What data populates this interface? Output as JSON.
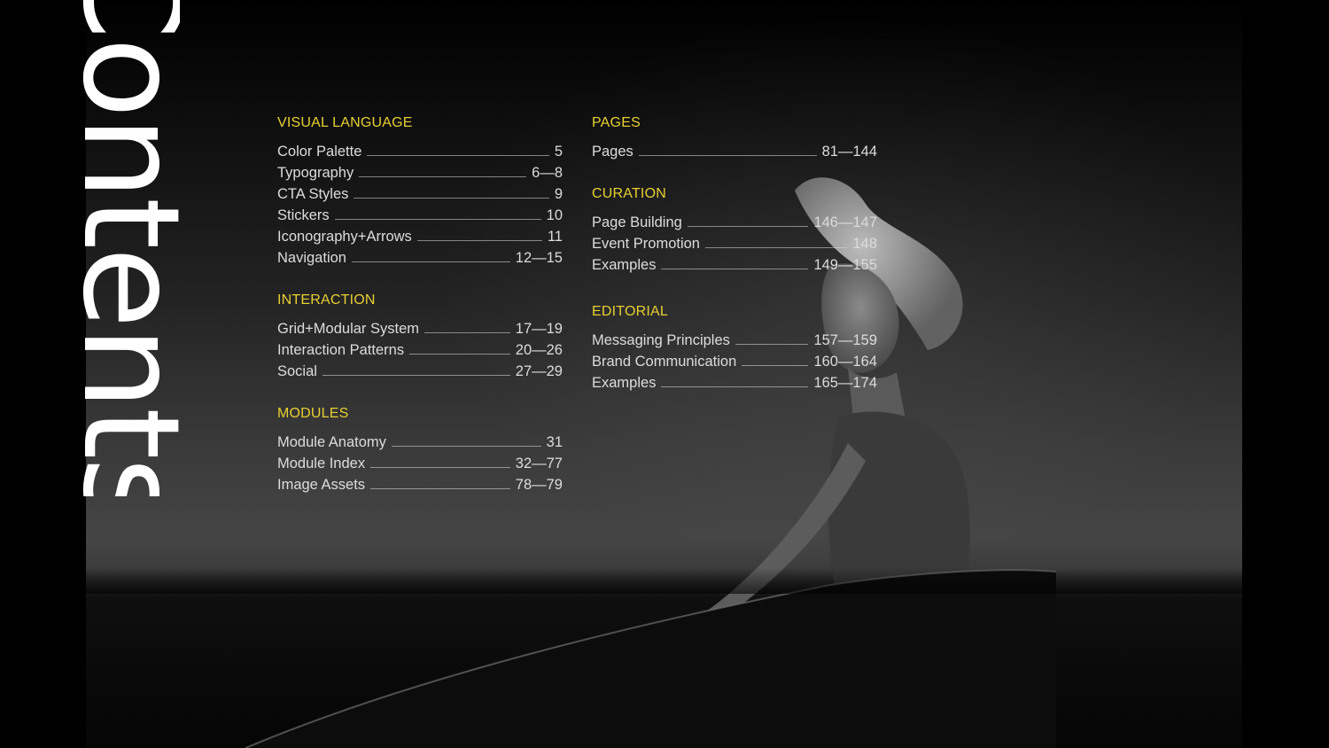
{
  "title": "Contents",
  "colors": {
    "accent": "#e8cf33",
    "text": "#dcdcdc",
    "background": "#000000"
  },
  "toc": {
    "left": [
      {
        "title": "VISUAL LANGUAGE",
        "items": [
          {
            "label": "Color Palette",
            "pages": "5"
          },
          {
            "label": "Typography",
            "pages": "6—8"
          },
          {
            "label": "CTA Styles",
            "pages": "9"
          },
          {
            "label": "Stickers",
            "pages": "10"
          },
          {
            "label": "Iconography+Arrows",
            "pages": "11"
          },
          {
            "label": "Navigation",
            "pages": "12—15"
          }
        ]
      },
      {
        "title": "INTERACTION",
        "items": [
          {
            "label": "Grid+Modular System",
            "pages": "17—19"
          },
          {
            "label": "Interaction Patterns",
            "pages": "20—26"
          },
          {
            "label": "Social",
            "pages": "27—29"
          }
        ]
      },
      {
        "title": "MODULES",
        "items": [
          {
            "label": "Module Anatomy",
            "pages": "31"
          },
          {
            "label": "Module Index",
            "pages": "32—77"
          },
          {
            "label": "Image Assets",
            "pages": "78—79"
          }
        ]
      }
    ],
    "right": [
      {
        "title": "PAGES",
        "items": [
          {
            "label": "Pages",
            "pages": "81—144"
          }
        ]
      },
      {
        "title": "CURATION",
        "items": [
          {
            "label": "Page Building",
            "pages": "146—147"
          },
          {
            "label": "Event Promotion",
            "pages": "148"
          },
          {
            "label": "Examples",
            "pages": "149—155"
          }
        ]
      },
      {
        "title": "EDITORIAL",
        "items": [
          {
            "label": "Messaging Principles",
            "pages": "157—159"
          },
          {
            "label": "Brand Communication",
            "pages": "160—164"
          },
          {
            "label": "Examples",
            "pages": "165—174"
          }
        ]
      }
    ]
  }
}
